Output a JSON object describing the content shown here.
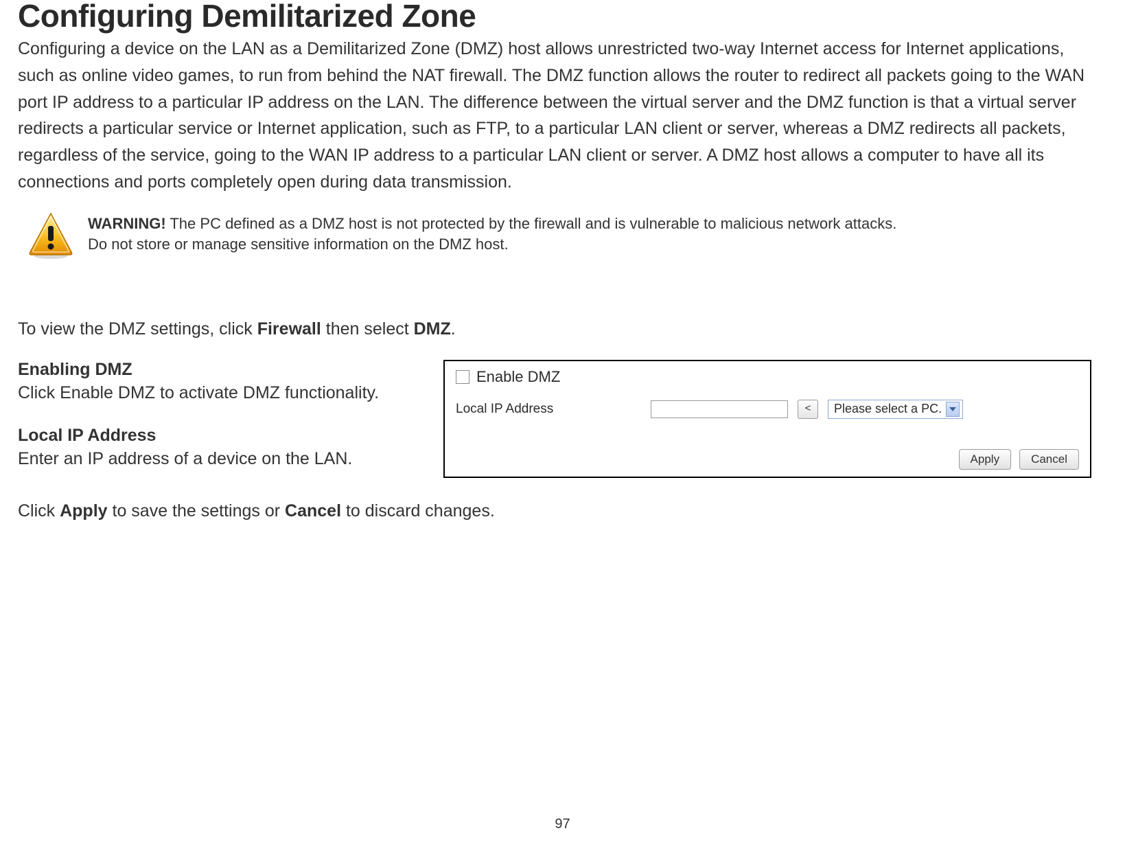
{
  "title": "Configuring Demilitarized Zone",
  "intro": "Configuring a device on the LAN as a Demilitarized Zone (DMZ) host allows unrestricted two-way Internet access for Internet applications, such as online video games, to run from behind the NAT firewall. The DMZ function allows the router to redirect all packets going to the WAN port IP address to a particular IP address on the LAN. The difference between the virtual server and the DMZ function is that a virtual server redirects a particular service or Internet application, such as FTP, to a particular LAN client or server, whereas a DMZ redirects all packets, regardless of the service, going to the WAN IP address to a particular LAN client or server. A DMZ host allows a computer to have all its connections and ports completely open during data transmission.",
  "warning": {
    "label": "WARNING!",
    "line1": " The PC defined as a DMZ host is not protected by the firewall and is vulnerable to malicious network attacks.",
    "line2": "Do not store or manage sensitive information on the DMZ host."
  },
  "nav": {
    "pre": "To view the DMZ settings, click ",
    "b1": "Firewall",
    "mid": " then select ",
    "b2": "DMZ",
    "post": "."
  },
  "sections": {
    "enable": {
      "hdr": "Enabling DMZ",
      "body": "Click Enable DMZ to activate DMZ functionality."
    },
    "localip": {
      "hdr": "Local IP Address",
      "body": "Enter an IP address of a device on the LAN."
    }
  },
  "screenshot": {
    "enable_label": "Enable DMZ",
    "field_label": "Local IP Address",
    "input_value": "",
    "arrow_label": "<",
    "select_text": "Please select a PC.",
    "apply": "Apply",
    "cancel": "Cancel"
  },
  "final": {
    "pre": "Click ",
    "b1": "Apply",
    "mid": " to save the settings or ",
    "b2": "Cancel",
    "post": " to discard changes."
  },
  "page_number": "97"
}
